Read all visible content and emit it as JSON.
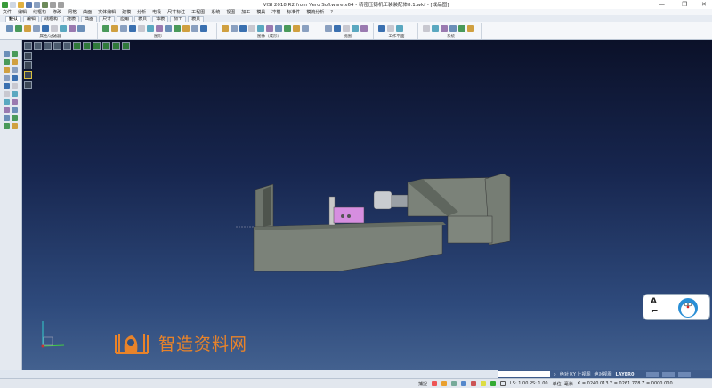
{
  "window": {
    "title": "VISI 2018 R2 from Vero Software x64 - 精密压铸机工装装配体8.1.wkf - [成品图]",
    "minimize": "—",
    "maximize": "❐",
    "close": "✕"
  },
  "menu": [
    "文件",
    "编辑",
    "线框构",
    "修改",
    "网格",
    "曲面",
    "实体编辑",
    "建模",
    "分析",
    "电极",
    "尺寸标注",
    "工程图",
    "系统",
    "视图",
    "加工",
    "模具",
    "冲模",
    "标准件",
    "模流分析",
    "?"
  ],
  "tabs": [
    {
      "label": "默认",
      "active": true
    },
    {
      "label": "编辑"
    },
    {
      "label": "线框构"
    },
    {
      "label": "建模"
    },
    {
      "label": "曲面"
    },
    {
      "label": "尺寸"
    },
    {
      "label": "应用"
    },
    {
      "label": "模具"
    },
    {
      "label": "冲模"
    },
    {
      "label": "加工"
    },
    {
      "label": "模具"
    }
  ],
  "ribbon_groups": [
    "属性/过滤器",
    "图形",
    "图像（成形）",
    "视图",
    "工作平面",
    "系统"
  ],
  "watermark": "智造资料网",
  "navcube": {
    "left": "A",
    "right": "⌐"
  },
  "cmdbar": {
    "view": "绝对 XY 上视图",
    "abs_view": "绝对视图",
    "layer": "LAYER0"
  },
  "status": {
    "snap": "捕捉",
    "scale": "LS: 1.00 PS: 1.00",
    "unit": "单位: 毫米",
    "coords": "X = 0240.013 Y = 0261.778 Z = 0000.000"
  },
  "colors": {
    "viewport_top": "#0b1129",
    "viewport_bottom": "#43618f",
    "model": "#7d847c",
    "part_accent": "#d68ee0",
    "watermark": "#e8832a"
  }
}
